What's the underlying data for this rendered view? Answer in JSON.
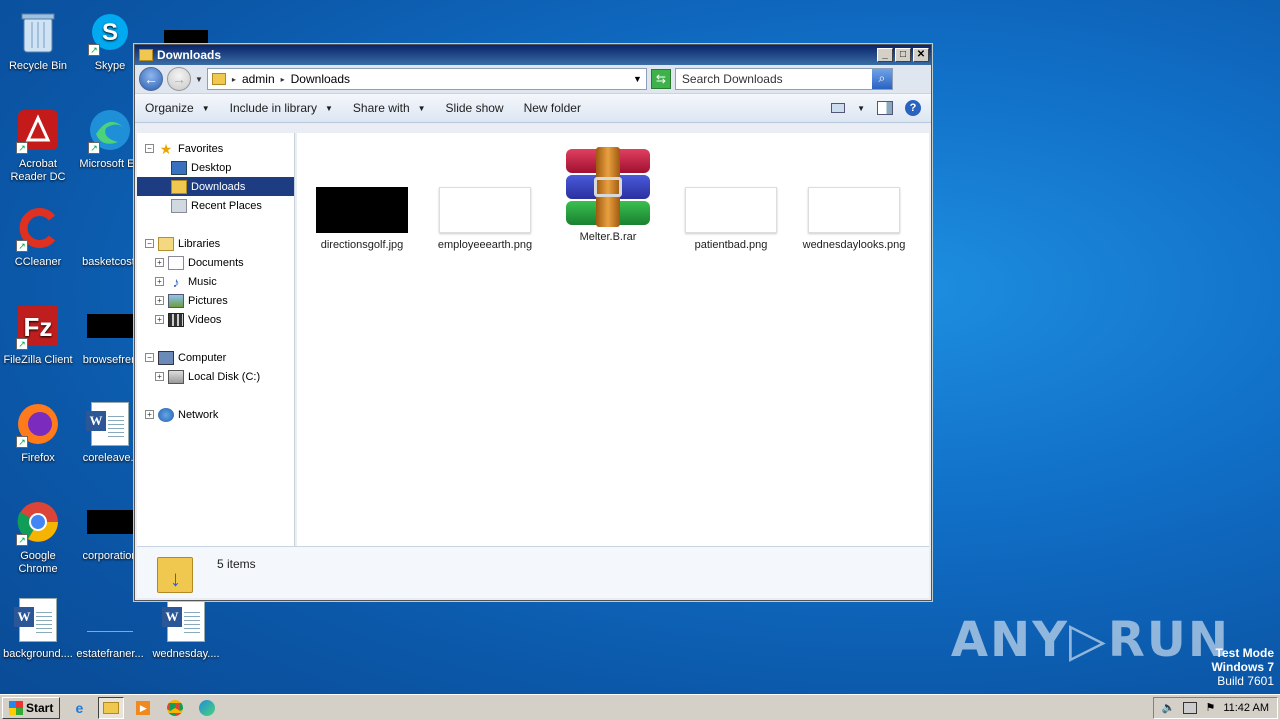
{
  "desktop": {
    "icons": [
      {
        "label": "Recycle Bin"
      },
      {
        "label": "Skype"
      },
      {
        "label": "Acrobat Reader DC"
      },
      {
        "label": "Microsoft Ed"
      },
      {
        "label": "CCleaner"
      },
      {
        "label": "basketcost."
      },
      {
        "label": "FileZilla Client"
      },
      {
        "label": "browsefren"
      },
      {
        "label": "Firefox"
      },
      {
        "label": "coreleave.r"
      },
      {
        "label": "Google Chrome"
      },
      {
        "label": "corporation"
      },
      {
        "label": "background...."
      },
      {
        "label": "estatefraner..."
      },
      {
        "label": "wednesday...."
      }
    ]
  },
  "window": {
    "title": "Downloads",
    "min": "_",
    "max": "□",
    "close": "✕",
    "address": {
      "parts": [
        "admin",
        "Downloads"
      ]
    },
    "search_placeholder": "Search Downloads",
    "toolbar": {
      "organize": "Organize",
      "include": "Include in library",
      "share": "Share with",
      "slideshow": "Slide show",
      "newfolder": "New folder"
    },
    "nav": {
      "favorites": "Favorites",
      "desktop": "Desktop",
      "downloads": "Downloads",
      "recent": "Recent Places",
      "libraries": "Libraries",
      "documents": "Documents",
      "music": "Music",
      "pictures": "Pictures",
      "videos": "Videos",
      "computer": "Computer",
      "localdisk": "Local Disk (C:)",
      "network": "Network"
    },
    "files": [
      {
        "name": "directionsgolf.jpg"
      },
      {
        "name": "employeeearth.png"
      },
      {
        "name": "Melter.B.rar"
      },
      {
        "name": "patientbad.png"
      },
      {
        "name": "wednesdaylooks.png"
      }
    ],
    "status": "5 items"
  },
  "watermark": "ANY▷RUN",
  "testmode": {
    "line1": "Test Mode",
    "line2": "Windows 7",
    "line3": "Build 7601"
  },
  "taskbar": {
    "start": "Start",
    "time": "11:42 AM"
  }
}
